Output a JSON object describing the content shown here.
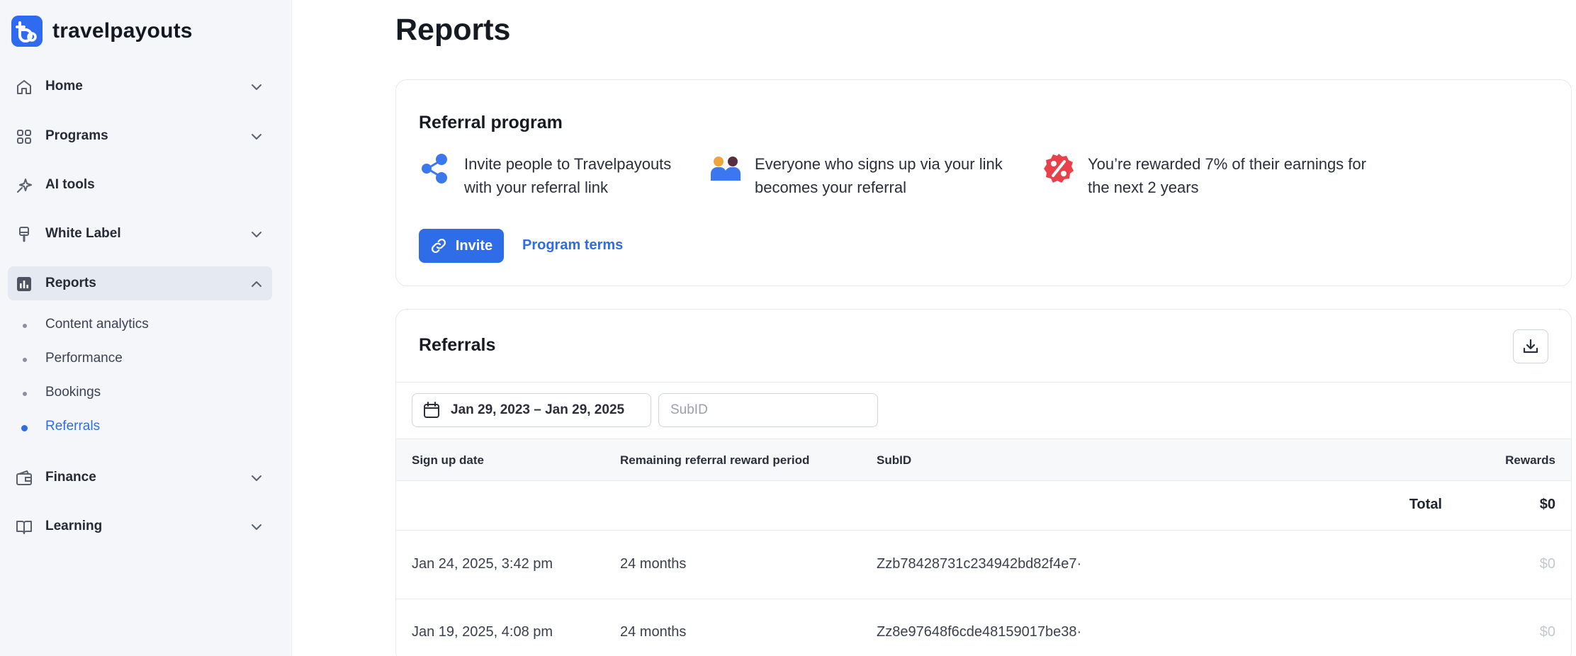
{
  "brand": {
    "name": "travelpayouts"
  },
  "sidebar": {
    "items": [
      {
        "label": "Home"
      },
      {
        "label": "Programs"
      },
      {
        "label": "AI tools"
      },
      {
        "label": "White Label"
      },
      {
        "label": "Reports"
      },
      {
        "label": "Finance"
      },
      {
        "label": "Learning"
      }
    ],
    "reports_sub": [
      {
        "label": "Content analytics"
      },
      {
        "label": "Performance"
      },
      {
        "label": "Bookings"
      },
      {
        "label": "Referrals"
      }
    ]
  },
  "page": {
    "title": "Reports"
  },
  "referral_program": {
    "title": "Referral program",
    "features": [
      {
        "text": "Invite people to Travelpayouts with your referral link"
      },
      {
        "text": "Everyone who signs up via your link becomes your referral"
      },
      {
        "text": "You’re rewarded 7% of their earnings for the next 2 years"
      }
    ],
    "invite_label": "Invite",
    "terms_label": "Program terms"
  },
  "referrals": {
    "title": "Referrals",
    "date_range": "Jan 29, 2023 – Jan 29, 2025",
    "subid_placeholder": "SubID",
    "columns": {
      "sign_up_date": "Sign up date",
      "remaining": "Remaining referral reward period",
      "subid": "SubID",
      "rewards": "Rewards"
    },
    "total_label": "Total",
    "total_value": "$0",
    "rows": [
      {
        "date": "Jan 24, 2025, 3:42 pm",
        "period": "24 months",
        "subid": "Zzb78428731c234942bd82f4e7·",
        "reward": "$0"
      },
      {
        "date": "Jan 19, 2025, 4:08 pm",
        "period": "24 months",
        "subid": "Zz8e97648f6cde48159017be38·",
        "reward": "$0"
      }
    ]
  },
  "colors": {
    "accent": "#2f6de8",
    "sidebar_bg": "#f4f6fa",
    "reward_muted": "#c4c8cf"
  }
}
